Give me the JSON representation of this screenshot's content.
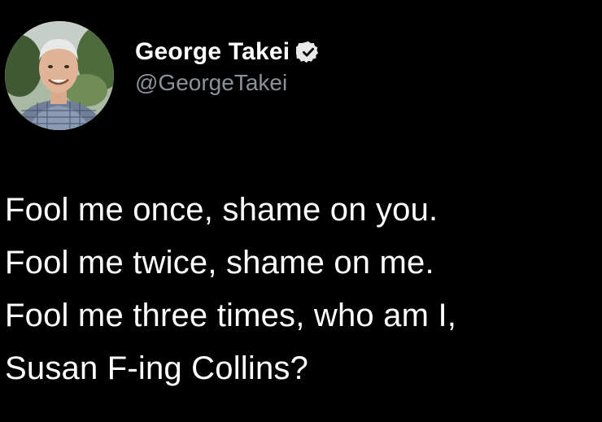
{
  "author": {
    "display_name": "George Takei",
    "handle": "@GeorgeTakei",
    "verified": true,
    "avatar": "profile-photo"
  },
  "tweet": {
    "lines": [
      "Fool me once, shame on you.",
      "Fool me twice, shame on me.",
      "Fool me three times, who am I,",
      "Susan F-ing Collins?"
    ]
  },
  "colors": {
    "background": "#000000",
    "text": "#ffffff",
    "handle": "#8b9299",
    "verified_badge": "#e7e9ea"
  },
  "icons": {
    "verified": "verified-badge-icon"
  }
}
